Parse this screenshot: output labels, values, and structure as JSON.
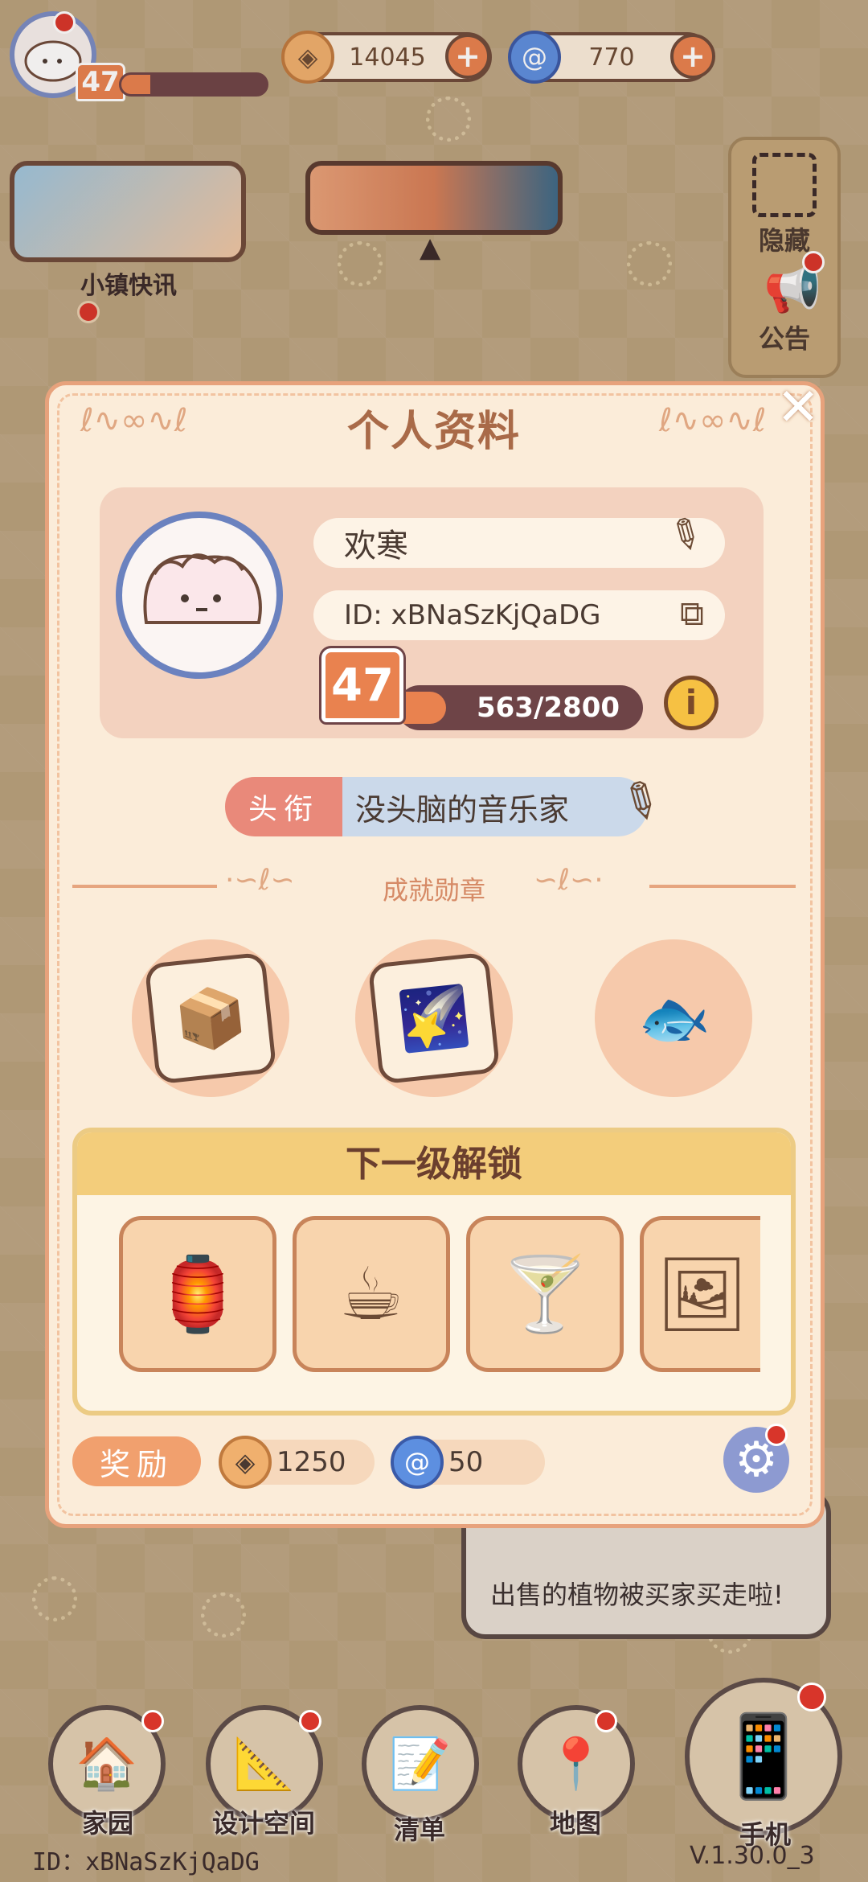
{
  "hud": {
    "player_level": "47",
    "level_progress": 0.2,
    "coins": "14045",
    "gems": "770"
  },
  "side": {
    "news_label": "小镇快讯",
    "hide_label": "隐藏",
    "notice_label": "公告"
  },
  "profile": {
    "title": "个人资料",
    "name": "欢寒",
    "id_text": "ID: xBNaSzKjQaDG",
    "level": "47",
    "xp_text": "563/2800",
    "xp_progress": 0.2,
    "title_tag": "头衔",
    "title_value": "没头脑的音乐家",
    "achievements_heading": "成就勋章",
    "unlock_heading": "下一级解锁",
    "reward_tag": "奖励",
    "reward_coins": "1250",
    "reward_gems": "50"
  },
  "notice": {
    "text": "出售的植物被买家买走啦!"
  },
  "nav": {
    "home": "家园",
    "design": "设计空间",
    "list": "清单",
    "map": "地图",
    "phone": "手机"
  },
  "footer": {
    "id": "ID：xBNaSzKjQaDG",
    "version": "V.1.30.0_3"
  },
  "colors": {
    "accent": "#e9824f",
    "panel": "#fbecd9",
    "avatar_ring": "#6b82bf"
  }
}
